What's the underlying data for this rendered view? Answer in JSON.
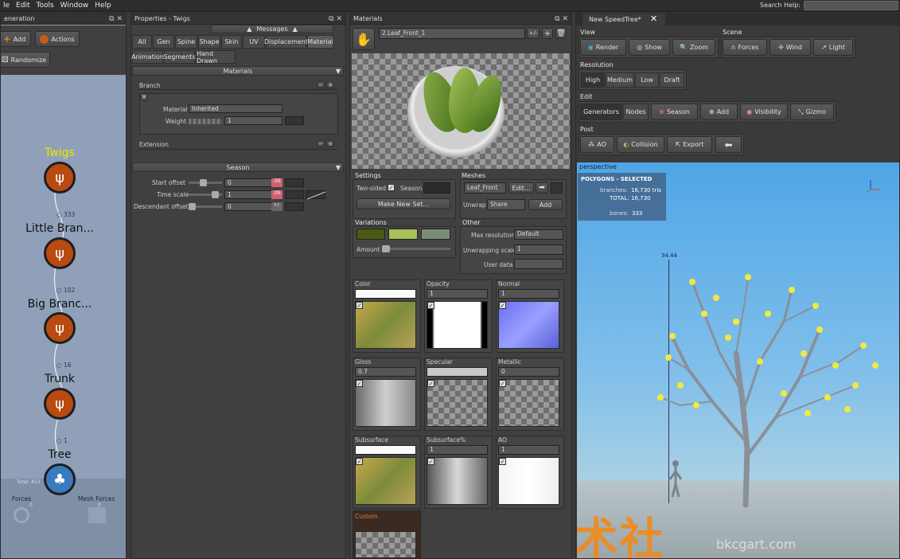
{
  "menubar": {
    "items": [
      "le",
      "Edit",
      "Tools",
      "Window",
      "Help"
    ],
    "search_label": "Search Help:"
  },
  "generation": {
    "title": "eneration",
    "add_label": "Add",
    "actions_label": "Actions",
    "randomize_label": "Randomize",
    "nodes": [
      {
        "name": "Twigs",
        "count": "333"
      },
      {
        "name": "Little Bran...",
        "count": "102"
      },
      {
        "name": "Big Branc...",
        "count": "16"
      },
      {
        "name": "Trunk",
        "count": "1"
      },
      {
        "name": "Tree",
        "count": ""
      }
    ],
    "total_label": "Total: 453",
    "forces_label": "Forces",
    "forces_count": "0",
    "mesh_forces_label": "Mesh Forces",
    "mesh_forces_count": "0"
  },
  "properties": {
    "title": "Properties - Twigs",
    "messages_label": "Messages",
    "tabs_row1": [
      "All",
      "Gen",
      "Spine",
      "Shape",
      "Skin",
      "UV",
      "Displacement",
      "Material"
    ],
    "tabs_row2": [
      "Animation",
      "Segments",
      "Hand Drawn"
    ],
    "materials_header": "Materials",
    "branch_label": "Branch",
    "material_label": "Material",
    "material_value": "Inherited",
    "weight_label": "Weight",
    "weight_value": "1",
    "extension_label": "Extension",
    "season_header": "Season",
    "start_offset_label": "Start offset",
    "start_offset_value": "0",
    "time_scale_label": "Time scale",
    "time_scale_value": "1",
    "descendant_offset_label": "Descendant offset",
    "descendant_offset_value": "0",
    "pink_badge": ".05",
    "pm_badge": "+/-"
  },
  "materials": {
    "title": "Materials",
    "selected_material": "2.Leaf_Front_1",
    "pm_label": "+/-",
    "settings_label": "Settings",
    "two_sided_label": "Two-sided",
    "season_label": "Season",
    "make_new_set_label": "Make New Set...",
    "meshes_label": "Meshes",
    "mesh_value": "Leaf_Front",
    "edit_label": "Edit...",
    "unwrap_label": "Unwrap",
    "unwrap_value": "Share",
    "add_label": "Add",
    "variations_label": "Variations",
    "amount_label": "Amount",
    "variation_colors": [
      "#4a5a12",
      "#a7c25a",
      "#7c8c78"
    ],
    "other_label": "Other",
    "max_resolution_label": "Max resolution",
    "max_resolution_value": "Default",
    "unwrapping_scale_label": "Unwrapping scale",
    "unwrapping_scale_value": "1",
    "user_data_label": "User data",
    "maps": [
      {
        "label": "Color",
        "value": ""
      },
      {
        "label": "Opacity",
        "value": "1"
      },
      {
        "label": "Normal",
        "value": "1"
      },
      {
        "label": "Gloss",
        "value": "0.7"
      },
      {
        "label": "Specular",
        "value": ""
      },
      {
        "label": "Metallic",
        "value": "0"
      },
      {
        "label": "Subsurface",
        "value": ""
      },
      {
        "label": "Subsurface%",
        "value": "1"
      },
      {
        "label": "AO",
        "value": "1"
      }
    ],
    "custom_label": "Custom"
  },
  "viewport": {
    "tab_title": "New SpeedTree*",
    "view_label": "View",
    "render_label": "Render",
    "show_label": "Show",
    "zoom_label": "Zoom",
    "scene_label": "Scene",
    "forces_label": "Forces",
    "wind_label": "Wind",
    "light_label": "Light",
    "resolution_label": "Resolution",
    "res_options": [
      "High",
      "Medium",
      "Low",
      "Draft"
    ],
    "edit_label": "Edit",
    "generators_label": "Generators",
    "nodes_label": "Nodes",
    "season_label": "Season",
    "add_label": "Add",
    "visibility_label": "Visibility",
    "gizmo_label": "Gizmo",
    "post_label": "Post",
    "ao_label": "AO",
    "collision_label": "Collision",
    "export_label": "Export",
    "perspective_label": "perspective",
    "stats_title": "POLYGONS - SELECTED",
    "branches_label": "branches:",
    "branches_value": "16,730 tris",
    "total_label": "TOTAL:",
    "total_value": "16,730",
    "bones_label": "bones:",
    "bones_value": "333",
    "height_value": "34.44",
    "watermark_text": "CG艺术社",
    "site_text": "bkcgart.com"
  }
}
